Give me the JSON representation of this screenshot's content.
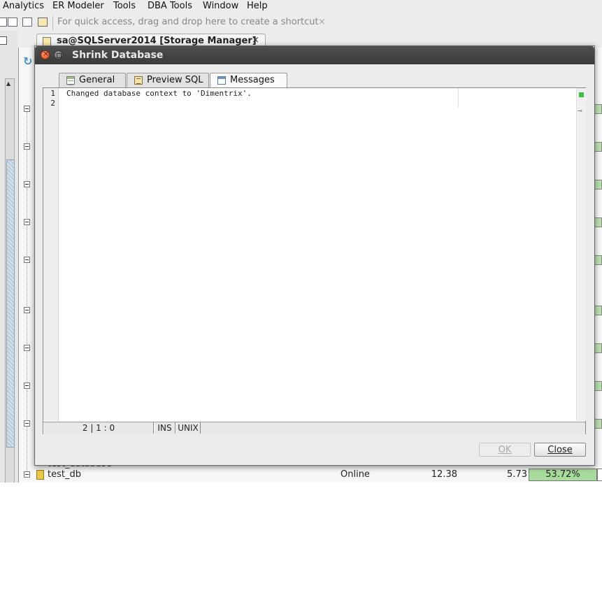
{
  "menubar": {
    "items": [
      {
        "label": "Analytics"
      },
      {
        "label": "ER Modeler"
      },
      {
        "label": "Tools"
      },
      {
        "label": "DBA Tools"
      },
      {
        "label": "Window"
      },
      {
        "label": "Help"
      }
    ]
  },
  "toolbar": {
    "quick_access_hint": "For quick access, drag and drop here to create a shortcut",
    "close_glyph": "×"
  },
  "editor_tab": {
    "title": "sa@SQLServer2014 [Storage Manager]",
    "close_glyph": "×"
  },
  "background_table": {
    "partial_row_text": "test_database",
    "row": {
      "name": "test_db",
      "status": "Online",
      "value1": "12.38",
      "value2": "5.73",
      "percent": "53.72%"
    }
  },
  "dialog": {
    "title": "Shrink Database",
    "tabs": [
      {
        "label": "General",
        "icon": "table-icon"
      },
      {
        "label": "Preview SQL",
        "icon": "sql-icon"
      },
      {
        "label": "Messages",
        "icon": "messages-icon",
        "active": true
      }
    ],
    "editor": {
      "line_numbers": [
        "1",
        "2"
      ],
      "lines": [
        "Changed database context to 'Dimentrix'.",
        ""
      ]
    },
    "statusbar": {
      "position": "2 | 1 : 0",
      "mode": "INS",
      "line_ending": "UNIX"
    },
    "buttons": {
      "ok": "OK",
      "close": "Close"
    }
  },
  "colors": {
    "dialog_titlebar": "#3f3f3f",
    "percent_fill": "#a8dc9c",
    "syntax_ok": "#3fbf3f"
  }
}
